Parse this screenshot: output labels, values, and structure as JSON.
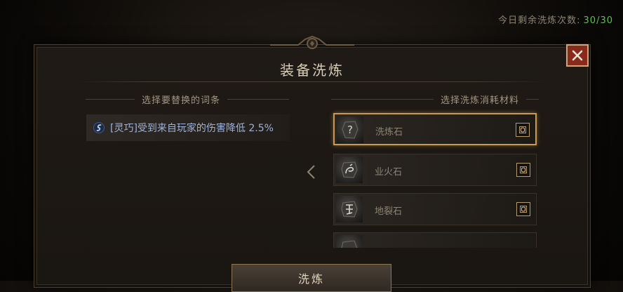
{
  "counter": {
    "label": "今日剩余洗炼次数:",
    "value": "30/30",
    "value_color": "#5fbf4f"
  },
  "dialog": {
    "title": "装备洗炼",
    "close_icon": "close-icon"
  },
  "left_section": {
    "header": "选择要替换的词条",
    "affixes": [
      {
        "icon": "affix-swirl-icon",
        "text": "[灵巧]受到来自玩家的伤害降低 2.5%"
      }
    ]
  },
  "right_section": {
    "header": "选择洗炼消耗材料",
    "materials": [
      {
        "name": "洗炼石",
        "selected": true,
        "icon": "question-rune-icon"
      },
      {
        "name": "业火石",
        "selected": false,
        "icon": "dragon-rune-icon"
      },
      {
        "name": "地裂石",
        "selected": false,
        "icon": "glyph-rune-icon"
      },
      {
        "name": "",
        "selected": false,
        "icon": "rune-stone-icon"
      }
    ]
  },
  "confirm_button": {
    "label": "洗炼"
  },
  "colors": {
    "accent_gold": "#c89a52",
    "close_red": "#8a2a1d"
  }
}
